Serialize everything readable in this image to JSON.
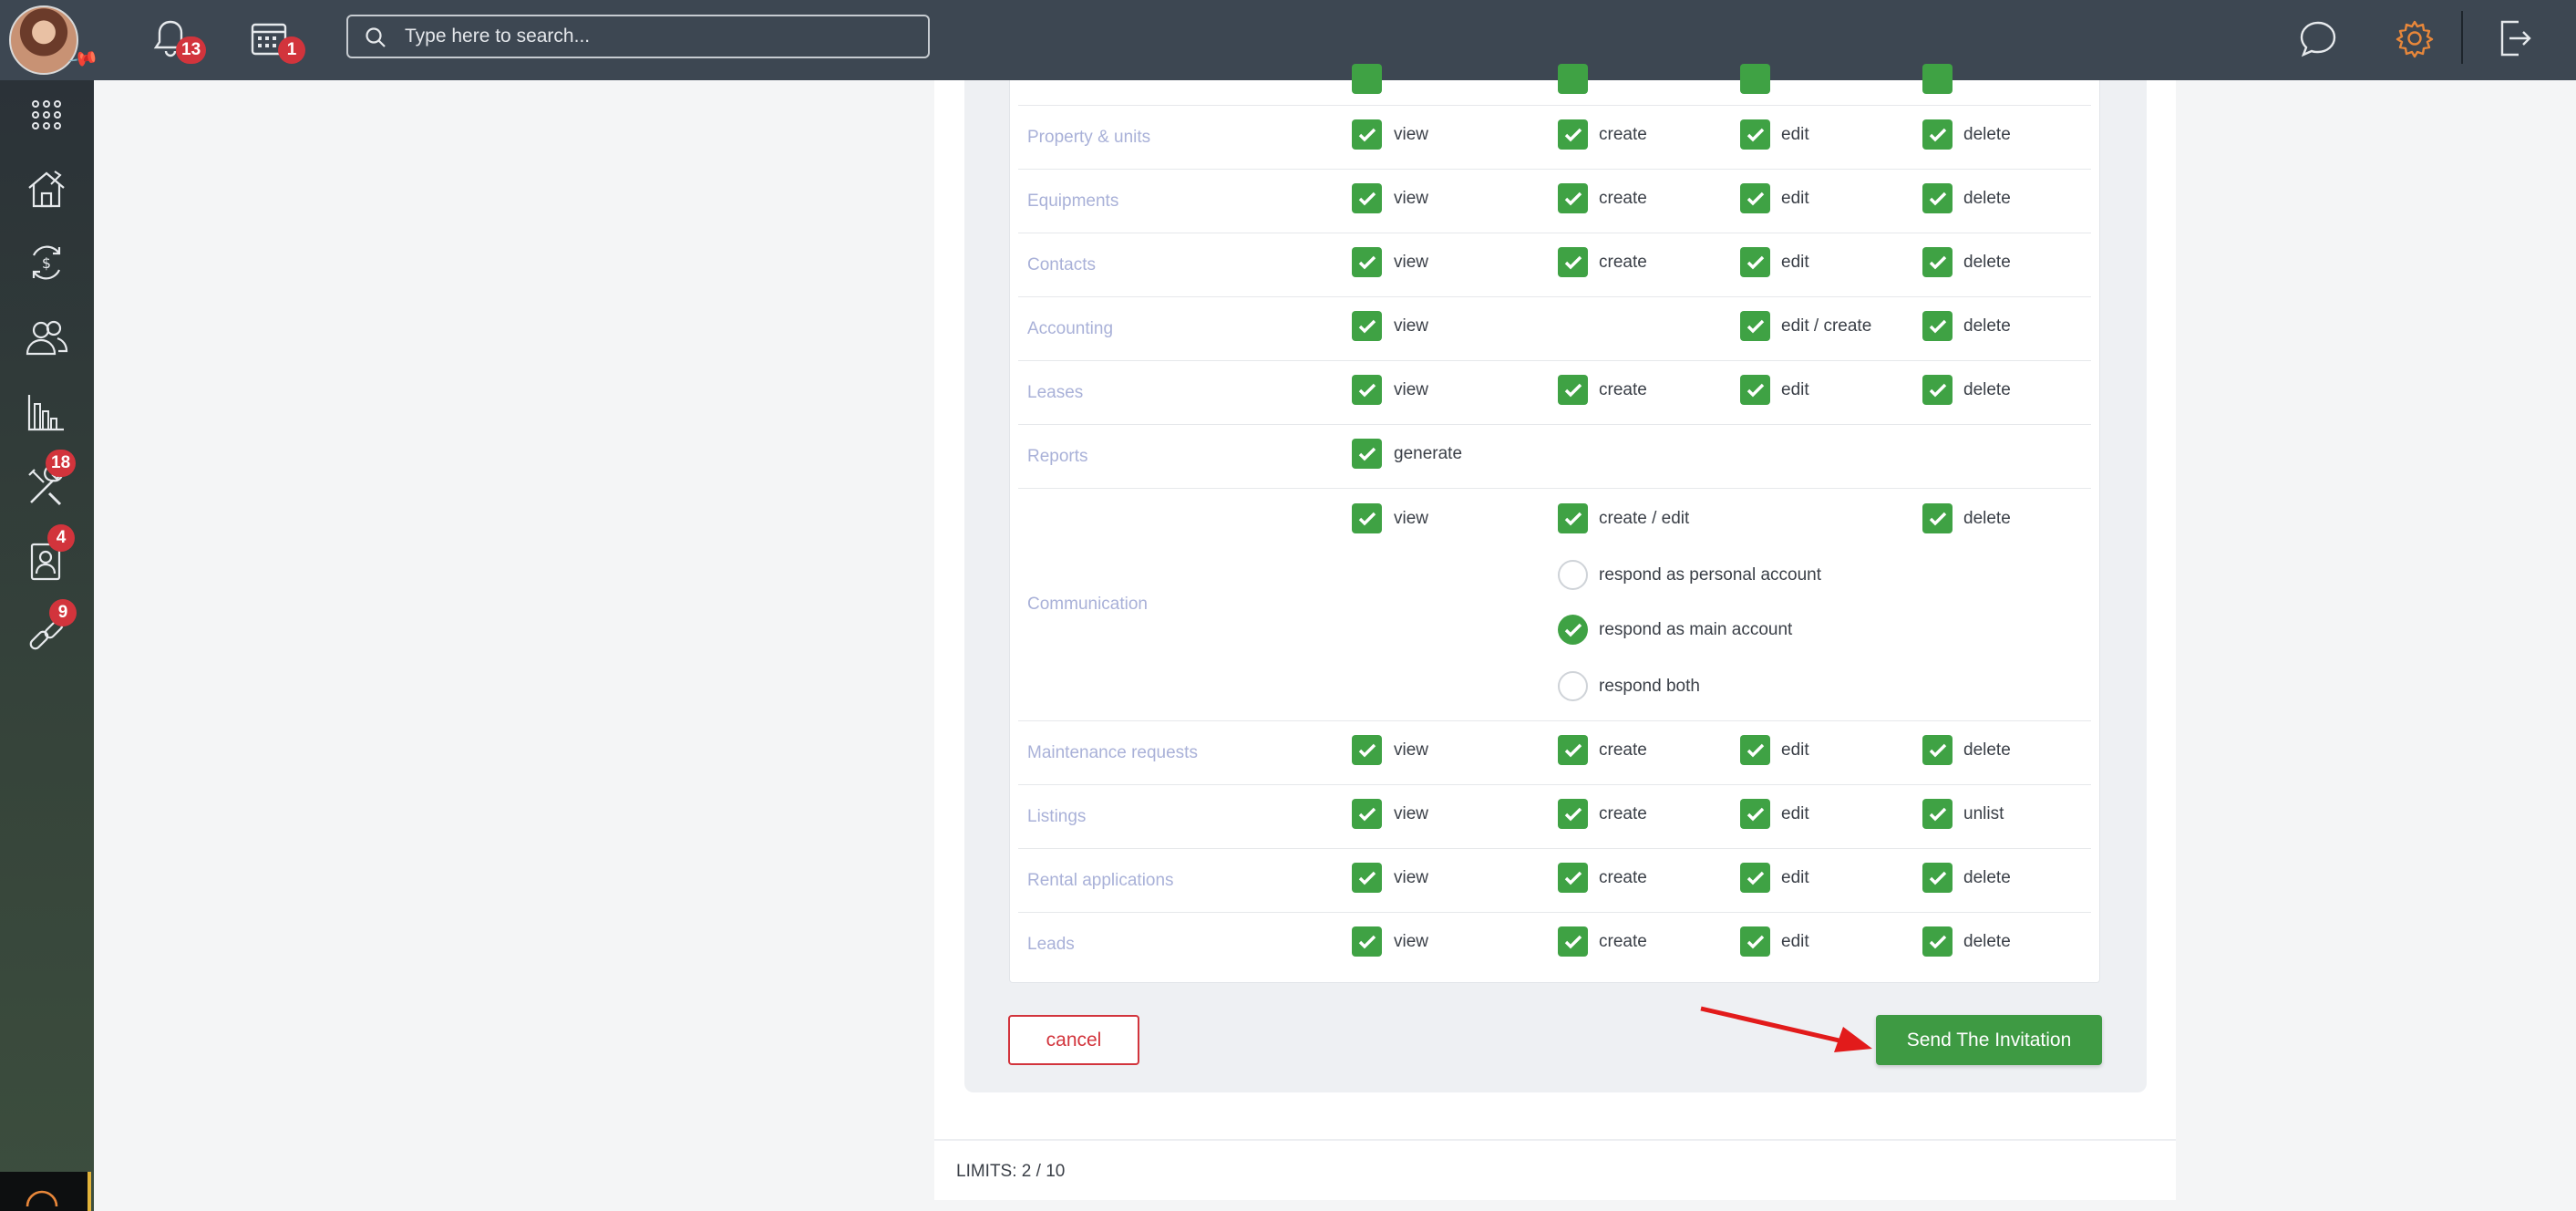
{
  "header": {
    "search_placeholder": "Type here to search...",
    "notifications_count": "13",
    "calendar_count": "1"
  },
  "sidebar": {
    "items": [
      {
        "icon": "apps-grid-icon",
        "badge": ""
      },
      {
        "icon": "property-house-icon",
        "badge": ""
      },
      {
        "icon": "money-cycle-icon",
        "badge": ""
      },
      {
        "icon": "people-icon",
        "badge": ""
      },
      {
        "icon": "bar-chart-icon",
        "badge": ""
      },
      {
        "icon": "tools-icon",
        "badge": "18"
      },
      {
        "icon": "tenant-card-icon",
        "badge": "4"
      },
      {
        "icon": "link-icon",
        "badge": "9"
      }
    ]
  },
  "permissions": {
    "rows": [
      {
        "label": "Property & units",
        "view": "view",
        "create": "create",
        "edit": "edit",
        "delete": "delete"
      },
      {
        "label": "Equipments",
        "view": "view",
        "create": "create",
        "edit": "edit",
        "delete": "delete"
      },
      {
        "label": "Contacts",
        "view": "view",
        "create": "create",
        "edit": "edit",
        "delete": "delete"
      },
      {
        "label": "Accounting",
        "view": "view",
        "edit": "edit / create",
        "delete": "delete"
      },
      {
        "label": "Leases",
        "view": "view",
        "create": "create",
        "edit": "edit",
        "delete": "delete"
      },
      {
        "label": "Reports",
        "view": "generate"
      },
      {
        "label": "Communication",
        "view": "view",
        "create": "create / edit",
        "delete": "delete"
      },
      {
        "label": "Maintenance requests",
        "view": "view",
        "create": "create",
        "edit": "edit",
        "delete": "delete"
      },
      {
        "label": "Listings",
        "view": "view",
        "create": "create",
        "edit": "edit",
        "delete": "unlist"
      },
      {
        "label": "Rental applications",
        "view": "view",
        "create": "create",
        "edit": "edit",
        "delete": "delete"
      },
      {
        "label": "Leads",
        "view": "view",
        "create": "create",
        "edit": "edit",
        "delete": "delete"
      }
    ],
    "communication_options": [
      {
        "label": "respond as personal account",
        "selected": false
      },
      {
        "label": "respond as main account",
        "selected": true
      },
      {
        "label": "respond both",
        "selected": false
      }
    ]
  },
  "actions": {
    "cancel_label": "cancel",
    "send_label": "Send The Invitation"
  },
  "footer": {
    "limits": "LIMITS: 2 / 10"
  },
  "colors": {
    "topbar": "#3d4752",
    "check_green": "#3fa244",
    "send_button": "#3e9a43",
    "cancel_red": "#d2343c",
    "badge_red": "#d2343c",
    "row_label": "#a9b1d8"
  }
}
